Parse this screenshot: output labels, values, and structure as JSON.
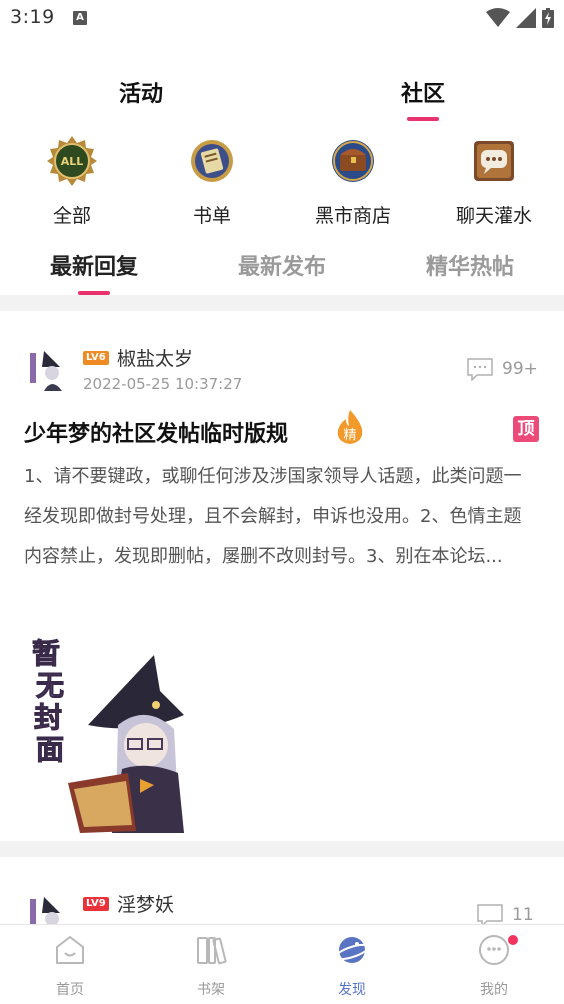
{
  "status": {
    "time": "3:19",
    "a_badge": "A"
  },
  "top_tabs": [
    {
      "label": "活动"
    },
    {
      "label": "社区"
    }
  ],
  "categories": [
    {
      "label": "全部",
      "icon": "all-icon",
      "icon_text": "ALL"
    },
    {
      "label": "书单",
      "icon": "booklist-icon"
    },
    {
      "label": "黑市商店",
      "icon": "treasure-chest-icon"
    },
    {
      "label": "聊天灌水",
      "icon": "chat-bubble-icon"
    }
  ],
  "sub_tabs": [
    {
      "label": "最新回复"
    },
    {
      "label": "最新发布"
    },
    {
      "label": "精华热帖"
    }
  ],
  "posts": [
    {
      "level": "LV6",
      "username": "椒盐太岁",
      "date": "2022-05-25 10:37:27",
      "comments": "99+",
      "title": "少年梦的社区发帖临时版规",
      "essence_badge": "精",
      "top_badge": "顶",
      "body": "1、请不要键政，或聊任何涉及涉国家领导人话题，此类问题一经发现即做封号处理，且不会解封，申诉也没用。2、色情主题内容禁止，发现即删帖，屡删不改则封号。3、别在本论坛...",
      "cover_text": [
        "暂",
        "无",
        "封",
        "面"
      ]
    },
    {
      "level": "LV9",
      "username": "淫梦妖",
      "comments": "11"
    }
  ],
  "bottom_nav": [
    {
      "label": "首页",
      "icon": "home-icon"
    },
    {
      "label": "书架",
      "icon": "bookshelf-icon"
    },
    {
      "label": "发现",
      "icon": "planet-icon"
    },
    {
      "label": "我的",
      "icon": "profile-face-icon"
    }
  ],
  "colors": {
    "accent": "#e8336f",
    "nav_active": "#5a74c4",
    "top_badge": "#ec4a79"
  }
}
